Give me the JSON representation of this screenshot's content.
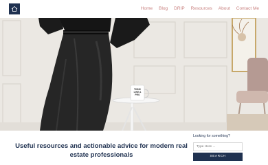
{
  "nav": {
    "items": [
      {
        "label": "Home"
      },
      {
        "label": "Blog"
      },
      {
        "label": "DRIP"
      },
      {
        "label": "Resources"
      },
      {
        "label": "About"
      },
      {
        "label": "Contact Me"
      }
    ]
  },
  "hero": {
    "mug_text": "Think like a pro"
  },
  "main": {
    "tagline": "Useful resources and actionable advice for modern real estate professionals"
  },
  "search": {
    "label": "Looking for something?",
    "placeholder": "Type Here ...",
    "button_label": "SEARCH"
  },
  "colors": {
    "brand_navy": "#1f3150",
    "nav_link": "#c8807f"
  }
}
